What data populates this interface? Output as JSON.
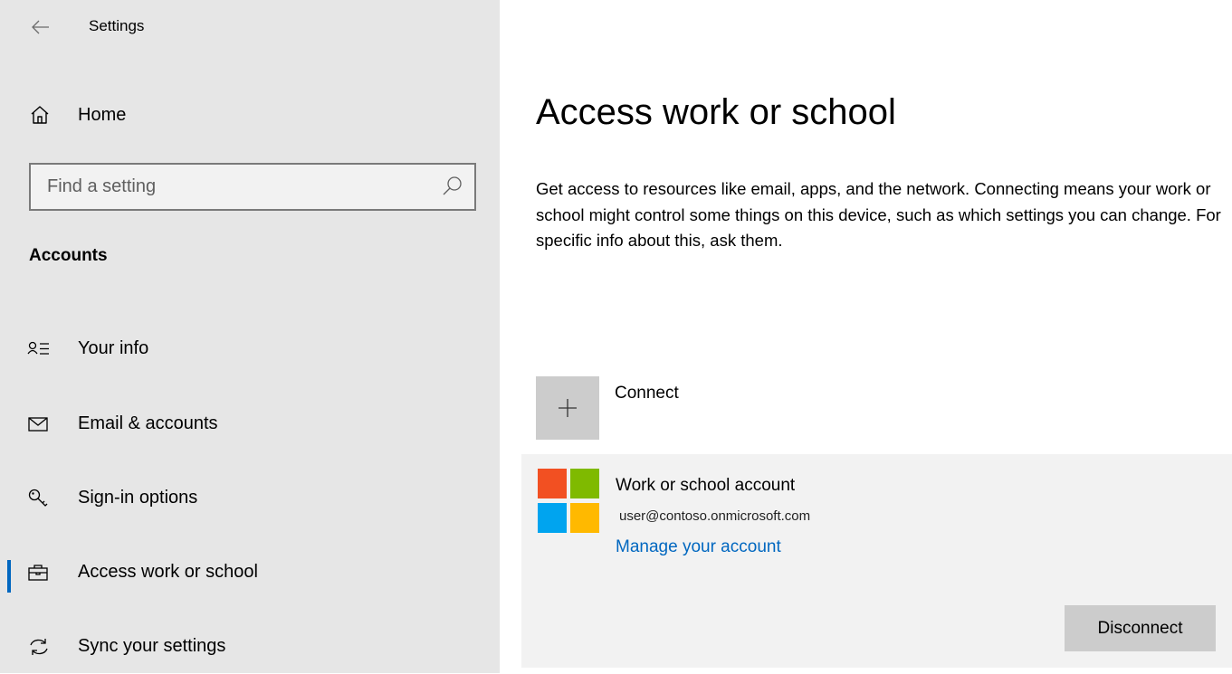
{
  "titlebar": {
    "app_title": "Settings",
    "back_icon": "arrow-left-icon",
    "minimize_icon": "minimize-icon"
  },
  "sidebar": {
    "home_label": "Home",
    "search_placeholder": "Find a setting",
    "search_value": "",
    "section_title": "Accounts",
    "items": [
      {
        "label": "Your info",
        "icon": "person-list-icon",
        "selected": false
      },
      {
        "label": "Email & accounts",
        "icon": "envelope-icon",
        "selected": false
      },
      {
        "label": "Sign-in options",
        "icon": "key-icon",
        "selected": false
      },
      {
        "label": "Access work or school",
        "icon": "briefcase-icon",
        "selected": true
      },
      {
        "label": "Sync your settings",
        "icon": "sync-icon",
        "selected": false
      }
    ]
  },
  "main": {
    "title": "Access work or school",
    "description": "Get access to resources like email, apps, and the network. Connecting means your work or school might control some things on this device, such as which settings you can change. For specific info about this, ask them.",
    "connect_label": "Connect",
    "account": {
      "name": "Work or school account",
      "email": "user@contoso.onmicrosoft.com",
      "manage_link": "Manage your account",
      "disconnect_label": "Disconnect"
    }
  },
  "colors": {
    "accent": "#0067c0",
    "sidebar_bg": "#e6e6e6",
    "panel_bg": "#f2f2f2",
    "tile_bg": "#cccccc",
    "ms_red": "#f25022",
    "ms_green": "#7fba00",
    "ms_blue": "#00a4ef",
    "ms_yellow": "#ffb900"
  }
}
